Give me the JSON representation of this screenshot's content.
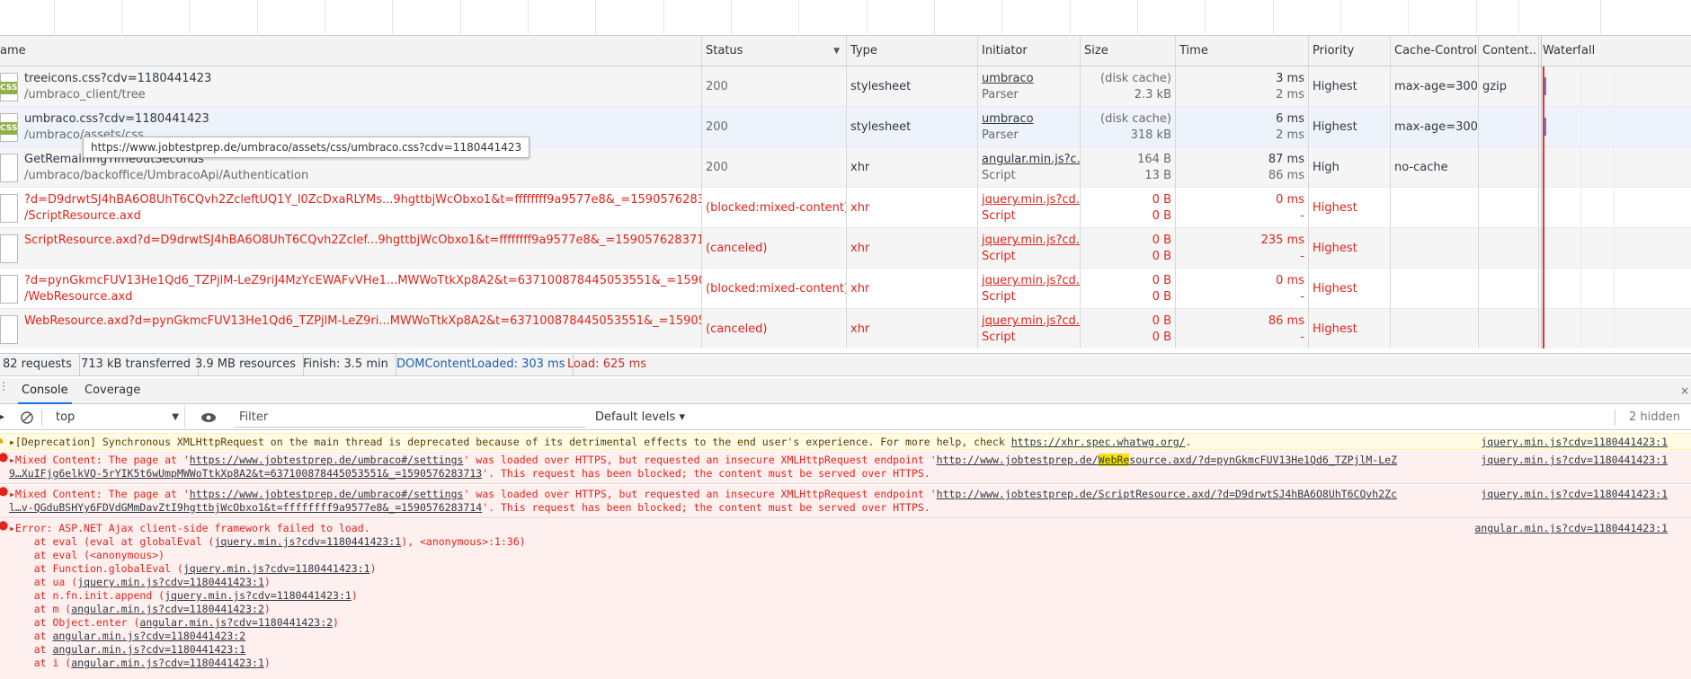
{
  "columns": {
    "name": "ame",
    "status": "Status",
    "type": "Type",
    "initiator": "Initiator",
    "size": "Size",
    "time": "Time",
    "priority": "Priority",
    "cache_control": "Cache-Control",
    "content": "Content...",
    "waterfall": "Waterfall"
  },
  "requests": [
    {
      "name": "treeicons.css?cdv=1180441423",
      "path": "/umbraco_client/tree",
      "status": "200",
      "type": "stylesheet",
      "initiator": "umbraco",
      "initiator_sub": "Parser",
      "size": "(disk cache)",
      "size_sub": "2.3 kB",
      "time": "3 ms",
      "time_sub": "2 ms",
      "priority": "Highest",
      "cache": "max-age=300",
      "content": "gzip",
      "icon": "css-file-icon",
      "error": false
    },
    {
      "name": "umbraco.css?cdv=1180441423",
      "path": "/umbraco/assets/css",
      "status": "200",
      "type": "stylesheet",
      "initiator": "umbraco",
      "initiator_sub": "Parser",
      "size": "(disk cache)",
      "size_sub": "318 kB",
      "time": "6 ms",
      "time_sub": "2 ms",
      "priority": "Highest",
      "cache": "max-age=300",
      "content": "",
      "icon": "css-file-icon",
      "error": false
    },
    {
      "name": "GetRemainingTimeoutSeconds",
      "path": "/umbraco/backoffice/UmbracoApi/Authentication",
      "status": "200",
      "type": "xhr",
      "initiator": "angular.min.js?c...",
      "initiator_sub": "Script",
      "size": "164 B",
      "size_sub": "13 B",
      "time": "87 ms",
      "time_sub": "86 ms",
      "priority": "High",
      "cache": "no-cache",
      "content": "",
      "icon": "file-icon",
      "error": false
    },
    {
      "name": "?d=D9drwtSJ4hBA6O8UhT6CQvh2ZcleftUQ1Y_l0ZcDxaRLYMs...9hgttbjWcObxo1&t=ffffffff9a9577e8&_=1590576283714",
      "path": "/ScriptResource.axd",
      "status": "(blocked:mixed-content)",
      "type": "xhr",
      "initiator": "jquery.min.js?cd...",
      "initiator_sub": "Script",
      "size": "0 B",
      "size_sub": "0 B",
      "time": "0 ms",
      "time_sub": "-",
      "priority": "Highest",
      "cache": "",
      "content": "",
      "icon": "file-icon",
      "error": true
    },
    {
      "name": "ScriptResource.axd?d=D9drwtSJ4hBA6O8UhT6CQvh2Zclef...9hgttbjWcObxo1&t=ffffffff9a9577e8&_=1590576283714",
      "path": "",
      "status": "(canceled)",
      "type": "xhr",
      "initiator": "jquery.min.js?cd...",
      "initiator_sub": "Script",
      "size": "0 B",
      "size_sub": "0 B",
      "time": "235 ms",
      "time_sub": "-",
      "priority": "Highest",
      "cache": "",
      "content": "",
      "icon": "file-icon",
      "error": true
    },
    {
      "name": "?d=pynGkmcFUV13He1Qd6_TZPjlM-LeZ9riJ4MzYcEWAFvVHe1...MWWoTtkXp8A2&t=637100878445053551&_=1590576283713",
      "path": "/WebResource.axd",
      "status": "(blocked:mixed-content)",
      "type": "xhr",
      "initiator": "jquery.min.js?cd...",
      "initiator_sub": "Script",
      "size": "0 B",
      "size_sub": "0 B",
      "time": "0 ms",
      "time_sub": "-",
      "priority": "Highest",
      "cache": "",
      "content": "",
      "icon": "file-icon",
      "error": true
    },
    {
      "name": "WebResource.axd?d=pynGkmcFUV13He1Qd6_TZPjlM-LeZ9ri...MWWoTtkXp8A2&t=637100878445053551&_=1590576283713",
      "path": "",
      "status": "(canceled)",
      "type": "xhr",
      "initiator": "jquery.min.js?cd...",
      "initiator_sub": "Script",
      "size": "0 B",
      "size_sub": "0 B",
      "time": "86 ms",
      "time_sub": "-",
      "priority": "Highest",
      "cache": "",
      "content": "",
      "icon": "file-icon",
      "error": true
    }
  ],
  "tooltip": "https://www.jobtestprep.de/umbraco/assets/css/umbraco.css?cdv=1180441423",
  "summary": {
    "requests": "82 requests",
    "transferred": "713 kB transferred",
    "resources": "3.9 MB resources",
    "finish": "Finish: 3.5 min",
    "dcl": "DOMContentLoaded: 303 ms",
    "load": "Load: 625 ms"
  },
  "drawer": {
    "tab_console": "Console",
    "tab_coverage": "Coverage",
    "close": "×"
  },
  "console_toolbar": {
    "context": "top",
    "filter_placeholder": "Filter",
    "levels": "Default levels ▾",
    "hidden": "2 hidden"
  },
  "messages": {
    "m1": {
      "line1": "▸[Deprecation] Synchronous XMLHttpRequest on the main thread is deprecated because of its detrimental effects to the end user's experience. For more help, check ",
      "link": "https://xhr.spec.whatwg.org/",
      "tail": ".",
      "src": "jquery.min.js?cdv=1180441423:1"
    },
    "m2": {
      "pre": "▸Mixed Content: The page at '",
      "page": "https://www.jobtestprep.de/umbraco#/settings",
      "mid": "' was loaded over HTTPS, but requested an insecure XMLHttpRequest endpoint '",
      "url_a": "http://www.jobtestprep.de/",
      "url_hl": "WebRe",
      "url_b": "source.axd/?d=pynGkmcFUV13He1Qd6_TZPjlM-LeZ",
      "line2_link": "9…XuIFjg6elkVQ-5rYIK5t6wUmpMWWoTtkXp8A2&t=637100878445053551&_=1590576283713",
      "line2_tail": "'. This request has been blocked; the content must be served over HTTPS.",
      "src": "jquery.min.js?cdv=1180441423:1"
    },
    "m3": {
      "pre": "▸Mixed Content: The page at '",
      "page": "https://www.jobtestprep.de/umbraco#/settings",
      "mid": "' was loaded over HTTPS, but requested an insecure XMLHttpRequest endpoint '",
      "url": "http://www.jobtestprep.de/ScriptResource.axd/?d=D9drwtSJ4hBA6O8UhT6CQvh2Zc",
      "line2_link": "l…v-QGduBSHYy6FDVdGMmDavZtI9hgttbjWcObxo1&t=ffffffff9a9577e8&_=1590576283714",
      "line2_tail": "'. This request has been blocked; the content must be served over HTTPS.",
      "src": "jquery.min.js?cdv=1180441423:1"
    },
    "m4": {
      "head": "▸Error: ASP.NET Ajax client-side framework failed to load.",
      "src": "angular.min.js?cdv=1180441423:1",
      "stack": [
        {
          "pre": "    at eval (eval at globalEval (",
          "link": "jquery.min.js?cdv=1180441423:1",
          "post": "), <anonymous>:1:36)"
        },
        {
          "pre": "    at eval (<anonymous>)",
          "link": "",
          "post": ""
        },
        {
          "pre": "    at Function.globalEval (",
          "link": "jquery.min.js?cdv=1180441423:1",
          "post": ")"
        },
        {
          "pre": "    at ua (",
          "link": "jquery.min.js?cdv=1180441423:1",
          "post": ")"
        },
        {
          "pre": "    at n.fn.init.append (",
          "link": "jquery.min.js?cdv=1180441423:1",
          "post": ")"
        },
        {
          "pre": "    at m (",
          "link": "angular.min.js?cdv=1180441423:2",
          "post": ")"
        },
        {
          "pre": "    at Object.enter (",
          "link": "angular.min.js?cdv=1180441423:2",
          "post": ")"
        },
        {
          "pre": "    at ",
          "link": "angular.min.js?cdv=1180441423:2",
          "post": ""
        },
        {
          "pre": "    at ",
          "link": "angular.min.js?cdv=1180441423:1",
          "post": ""
        },
        {
          "pre": "    at i (",
          "link": "angular.min.js?cdv=1180441423:1",
          "post": ")"
        }
      ]
    }
  }
}
